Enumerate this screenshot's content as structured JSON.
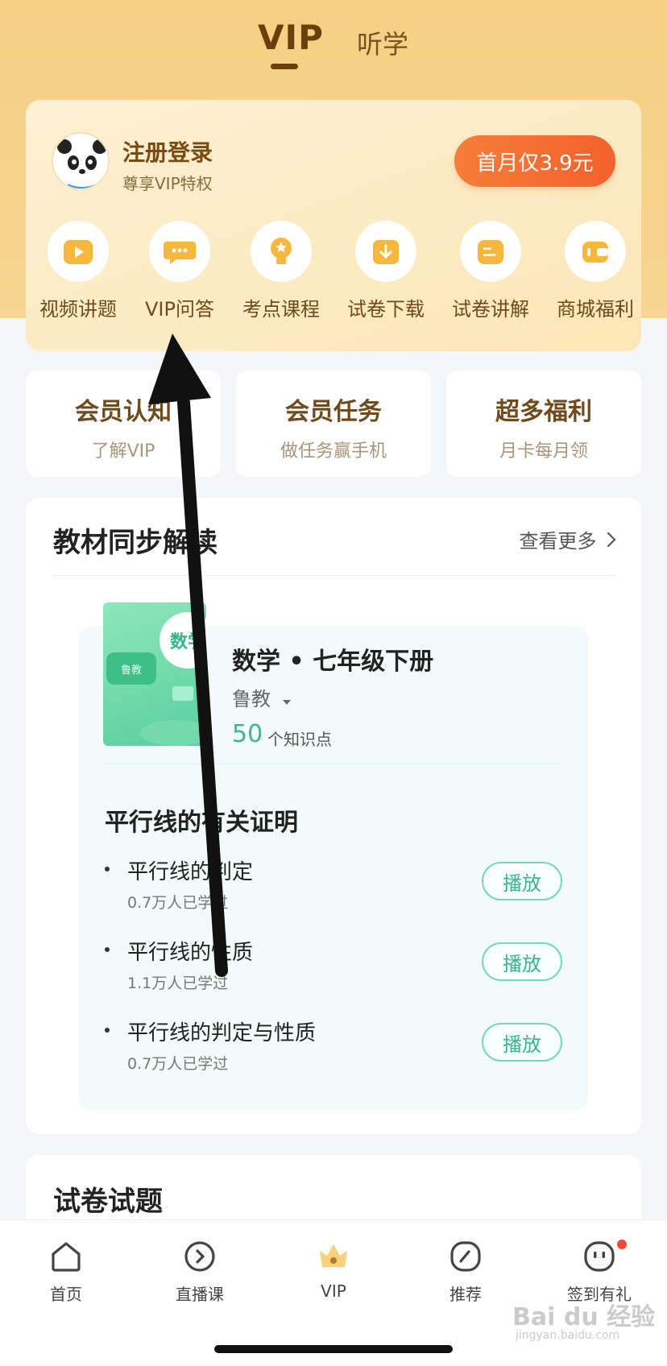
{
  "header": {
    "tabs": [
      {
        "label": "VIP"
      },
      {
        "label": "听学"
      }
    ]
  },
  "vip_card": {
    "login_title": "注册登录",
    "login_subtitle": "尊享VIP特权",
    "price_button": "首月仅3.9元",
    "features": [
      {
        "label": "视频讲题",
        "icon": "video-icon"
      },
      {
        "label": "VIP问答",
        "icon": "chat-icon"
      },
      {
        "label": "考点课程",
        "icon": "bulb-icon"
      },
      {
        "label": "试卷下载",
        "icon": "download-icon"
      },
      {
        "label": "试卷讲解",
        "icon": "paper-icon"
      },
      {
        "label": "商城福利",
        "icon": "wallet-icon"
      }
    ]
  },
  "mini_cards": [
    {
      "title": "会员认知",
      "subtitle": "了解VIP"
    },
    {
      "title": "会员任务",
      "subtitle": "做任务赢手机"
    },
    {
      "title": "超多福利",
      "subtitle": "月卡每月领"
    }
  ],
  "textbook_section": {
    "title": "教材同步解读",
    "see_more": "查看更多",
    "book": {
      "cover_subject": "数学",
      "cover_tag": "鲁教",
      "title": "数学 • 七年级下册",
      "publisher": "鲁教",
      "count": "50",
      "count_label": "个知识点"
    },
    "chapter": "平行线的有关证明",
    "lessons": [
      {
        "title": "平行线的判定",
        "learners": "0.7万人已学过",
        "play": "播放"
      },
      {
        "title": "平行线的性质",
        "learners": "1.1万人已学过",
        "play": "播放"
      },
      {
        "title": "平行线的判定与性质",
        "learners": "0.7万人已学过",
        "play": "播放"
      }
    ]
  },
  "exam_section": {
    "title": "试卷试题"
  },
  "bottom_nav": [
    {
      "label": "首页",
      "icon": "home-icon"
    },
    {
      "label": "直播课",
      "icon": "live-icon"
    },
    {
      "label": "VIP",
      "icon": "crown-icon"
    },
    {
      "label": "推荐",
      "icon": "compass-icon"
    },
    {
      "label": "签到有礼",
      "icon": "checkin-icon"
    }
  ],
  "watermark": {
    "text": "Bai du 经验",
    "sub": "jingyan.baidu.com"
  },
  "colors": {
    "brand_gold": "#6a3f0c",
    "price_orange": "#f3612c",
    "teal": "#35b594"
  }
}
